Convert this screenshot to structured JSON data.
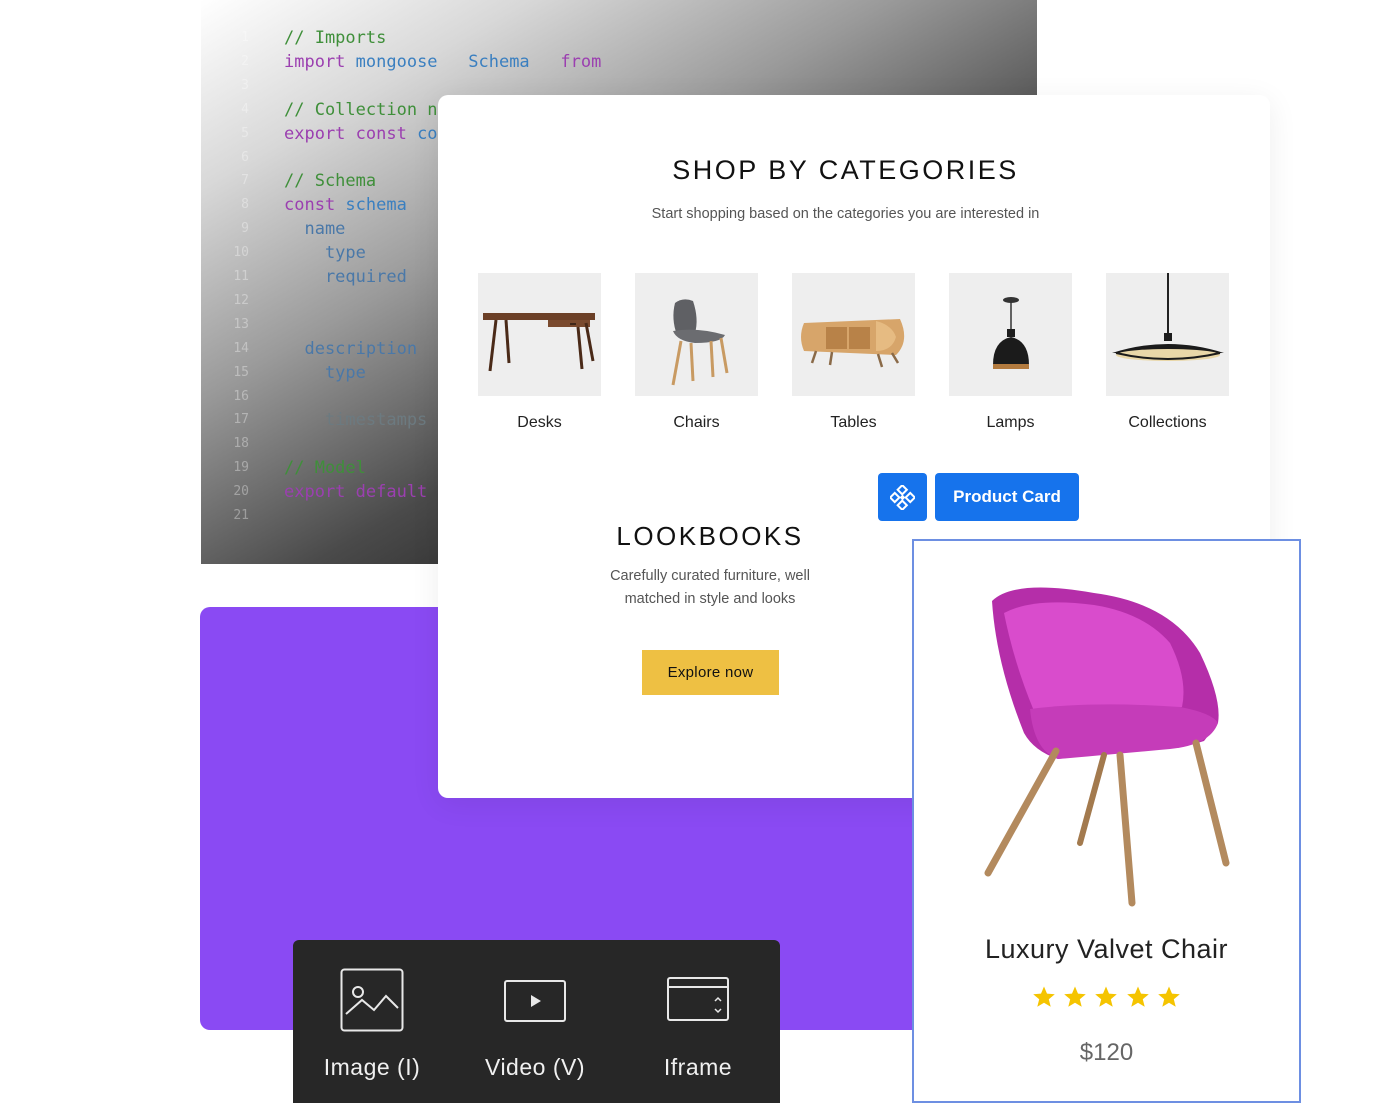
{
  "code_editor": {
    "lines": [
      {
        "num": "1",
        "parts": [
          {
            "t": "// Imports",
            "c": "c-comment"
          }
        ]
      },
      {
        "num": "2",
        "parts": [
          {
            "t": "import ",
            "c": "c-kw"
          },
          {
            "t": "mongoose",
            "c": "c-id"
          },
          {
            "t": "   Schema",
            "c": "c-id"
          },
          {
            "t": "   from",
            "c": "c-kw"
          }
        ]
      },
      {
        "num": "3",
        "parts": []
      },
      {
        "num": "4",
        "parts": [
          {
            "t": "// Collection n",
            "c": "c-comment"
          }
        ]
      },
      {
        "num": "5",
        "parts": [
          {
            "t": "export const ",
            "c": "c-kw"
          },
          {
            "t": "co",
            "c": "c-id"
          }
        ]
      },
      {
        "num": "6",
        "parts": []
      },
      {
        "num": "7",
        "parts": [
          {
            "t": "// Schema",
            "c": "c-comment"
          }
        ]
      },
      {
        "num": "8",
        "parts": [
          {
            "t": "const ",
            "c": "c-kw"
          },
          {
            "t": "schema",
            "c": "c-id"
          }
        ]
      },
      {
        "num": "9",
        "parts": [
          {
            "t": "  name",
            "c": "c-prop"
          }
        ]
      },
      {
        "num": "10",
        "parts": [
          {
            "t": "    type",
            "c": "c-prop"
          }
        ]
      },
      {
        "num": "11",
        "parts": [
          {
            "t": "    required",
            "c": "c-prop"
          }
        ]
      },
      {
        "num": "12",
        "parts": []
      },
      {
        "num": "13",
        "parts": []
      },
      {
        "num": "14",
        "parts": [
          {
            "t": "  description",
            "c": "c-prop"
          }
        ]
      },
      {
        "num": "15",
        "parts": [
          {
            "t": "    type",
            "c": "c-prop"
          }
        ]
      },
      {
        "num": "16",
        "parts": []
      },
      {
        "num": "17",
        "parts": [
          {
            "t": "    timestamps",
            "c": "c-dim"
          }
        ]
      },
      {
        "num": "18",
        "parts": []
      },
      {
        "num": "19",
        "parts": [
          {
            "t": "// Model",
            "c": "c-comment"
          }
        ]
      },
      {
        "num": "20",
        "parts": [
          {
            "t": "export default",
            "c": "c-kw"
          }
        ]
      },
      {
        "num": "21",
        "parts": []
      }
    ]
  },
  "shop": {
    "title": "SHOP BY CATEGORIES",
    "subtitle": "Start shopping based on the categories you are interested in",
    "categories": [
      {
        "label": "Desks"
      },
      {
        "label": "Chairs"
      },
      {
        "label": "Tables"
      },
      {
        "label": "Lamps"
      },
      {
        "label": "Collections"
      }
    ]
  },
  "lookbooks": {
    "title": "LOOKBOOKS",
    "desc_line1": "Carefully curated furniture, well",
    "desc_line2": "matched in style and looks",
    "button": "Explore now"
  },
  "component_tag": {
    "icon": "component-icon",
    "label": "Product Card"
  },
  "product": {
    "name": "Luxury Valvet Chair",
    "rating": 5,
    "rating_max": 5,
    "price": "$120",
    "star_color": "#f5c400",
    "chair_color": "#c93bbf"
  },
  "media_toolbar": {
    "items": [
      {
        "label": "Image (I)",
        "icon": "image-icon"
      },
      {
        "label": "Video (V)",
        "icon": "video-icon"
      },
      {
        "label": "Iframe",
        "icon": "iframe-icon"
      }
    ]
  },
  "colors": {
    "accent_blue": "#1673ec",
    "purple": "#8a4af3",
    "button_yellow": "#eec043",
    "toolbar_bg": "#272727"
  }
}
